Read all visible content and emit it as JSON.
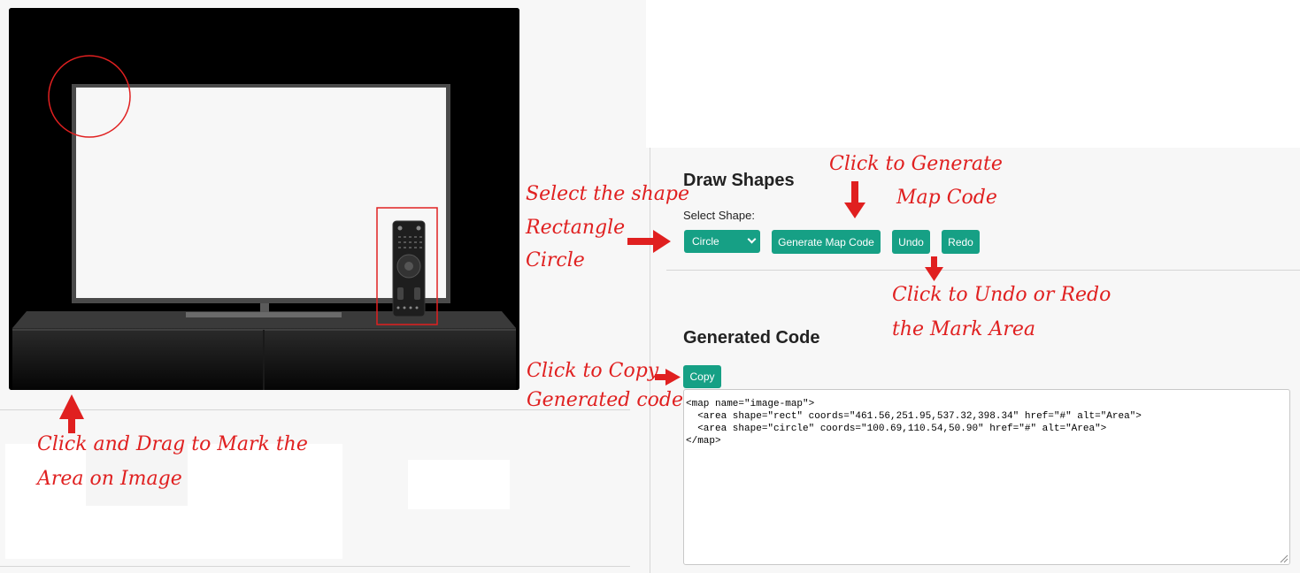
{
  "draw_shapes": {
    "title": "Draw Shapes",
    "select_label": "Select Shape:",
    "shape_selected": "Circle",
    "generate_label": "Generate Map Code",
    "undo_label": "Undo",
    "redo_label": "Redo"
  },
  "generated": {
    "title": "Generated Code",
    "copy_label": "Copy",
    "code_lines": [
      "<map name=\"image-map\">",
      "  <area shape=\"rect\" coords=\"461.56,251.95,537.32,398.34\" href=\"#\" alt=\"Area\">",
      "  <area shape=\"circle\" coords=\"100.69,110.54,50.90\" href=\"#\" alt=\"Area\">",
      "</map>"
    ]
  },
  "annotations": {
    "generate_1": "Click to Generate",
    "generate_2": "Map Code",
    "shape_1": "Select the shape",
    "shape_2": "Rectangle",
    "shape_3": "Circle",
    "undo_1": "Click to Undo or Redo",
    "undo_2": "the Mark Area",
    "copy_1": "Click to Copy",
    "copy_2": "Generated code",
    "drag_1": "Click and Drag to Mark the",
    "drag_2": "Area on Image"
  },
  "colors": {
    "accent": "#16a085",
    "annotation": "#e02020",
    "canvas_bg": "#000000"
  },
  "icons": {
    "arrow": "red-arrow-icon",
    "remote": "remote-control-icon",
    "tv": "television-icon"
  }
}
